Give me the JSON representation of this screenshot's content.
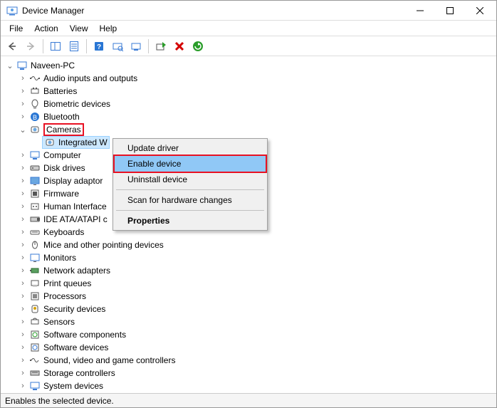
{
  "window": {
    "title": "Device Manager"
  },
  "menu": {
    "file": "File",
    "action": "Action",
    "view": "View",
    "help": "Help"
  },
  "tree": {
    "root": "Naveen-PC",
    "items": [
      "Audio inputs and outputs",
      "Batteries",
      "Biometric devices",
      "Bluetooth",
      "Cameras",
      "Computer",
      "Disk drives",
      "Display adaptor",
      "Firmware",
      "Human Interface",
      "IDE ATA/ATAPI c",
      "Keyboards",
      "Mice and other pointing devices",
      "Monitors",
      "Network adapters",
      "Print queues",
      "Processors",
      "Security devices",
      "Sensors",
      "Software components",
      "Software devices",
      "Sound, video and game controllers",
      "Storage controllers",
      "System devices"
    ],
    "cameras_child": "Integrated W"
  },
  "context_menu": {
    "update": "Update driver",
    "enable": "Enable device",
    "uninstall": "Uninstall device",
    "scan": "Scan for hardware changes",
    "properties": "Properties"
  },
  "status": "Enables the selected device."
}
